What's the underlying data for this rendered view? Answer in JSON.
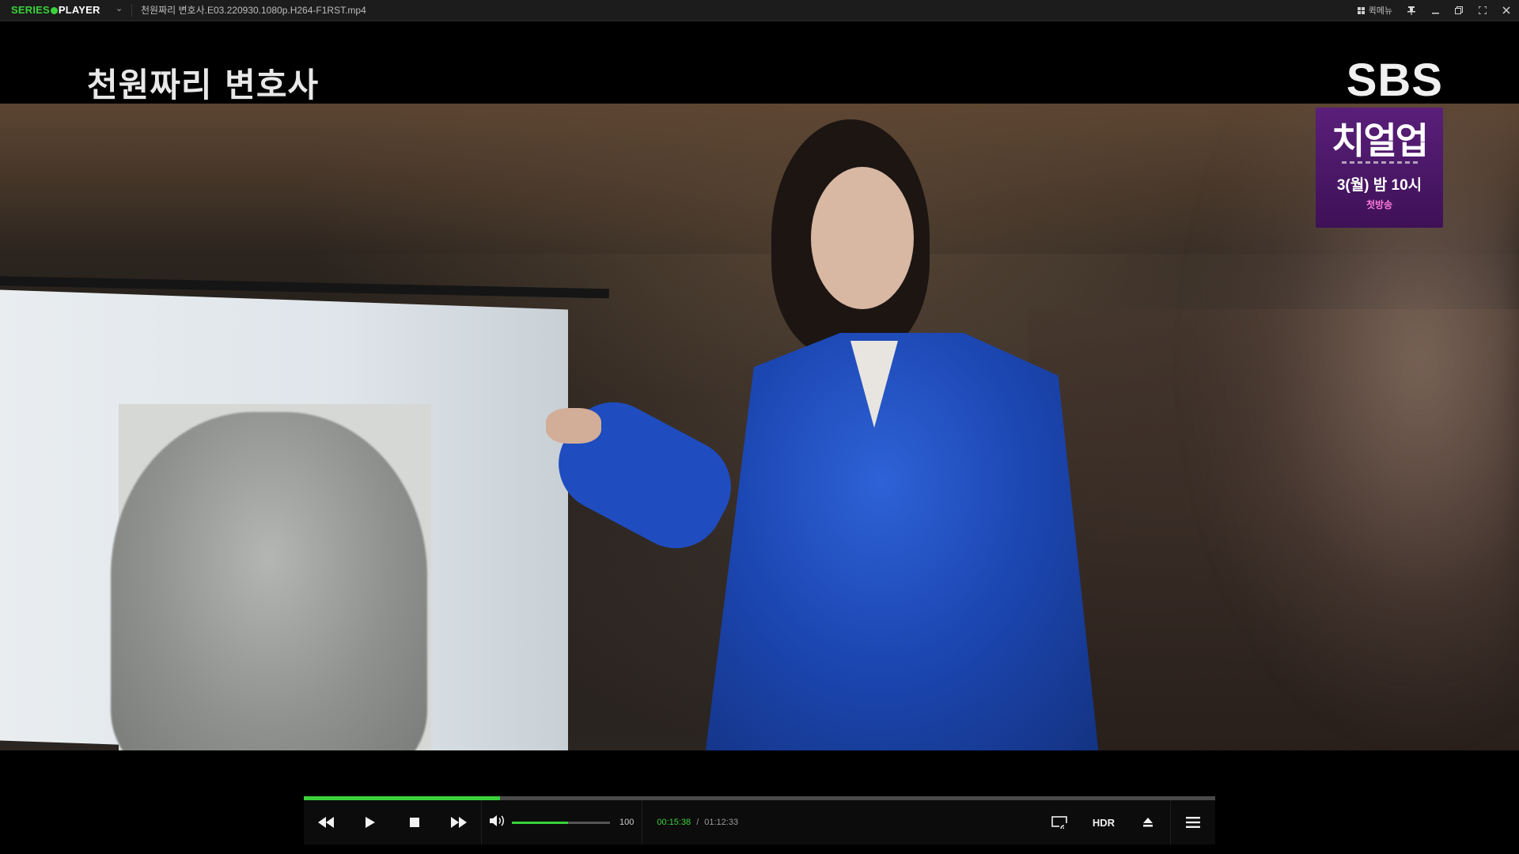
{
  "titlebar": {
    "brand": {
      "word1": "SERIES",
      "word2": "PLAYER"
    },
    "filename": "천원짜리 변호사.E03.220930.1080p.H264-F1RST.mp4",
    "quick_menu_label": "퀵메뉴"
  },
  "overlay": {
    "show_title": "천원짜리 변호사",
    "network_logo": "SBS",
    "promo": {
      "title": "치얼업",
      "schedule": "3(월) 밤 10시",
      "badge": "첫방송"
    }
  },
  "player": {
    "progress_fraction": 0.215,
    "volume_fraction": 0.57,
    "volume_value": "100",
    "current_time": "00:15:38",
    "separator": "/",
    "total_time": "01:12:33",
    "hdr_label": "HDR"
  },
  "colors": {
    "accent": "#3ad23a",
    "promo_bg": "#4a1668"
  }
}
